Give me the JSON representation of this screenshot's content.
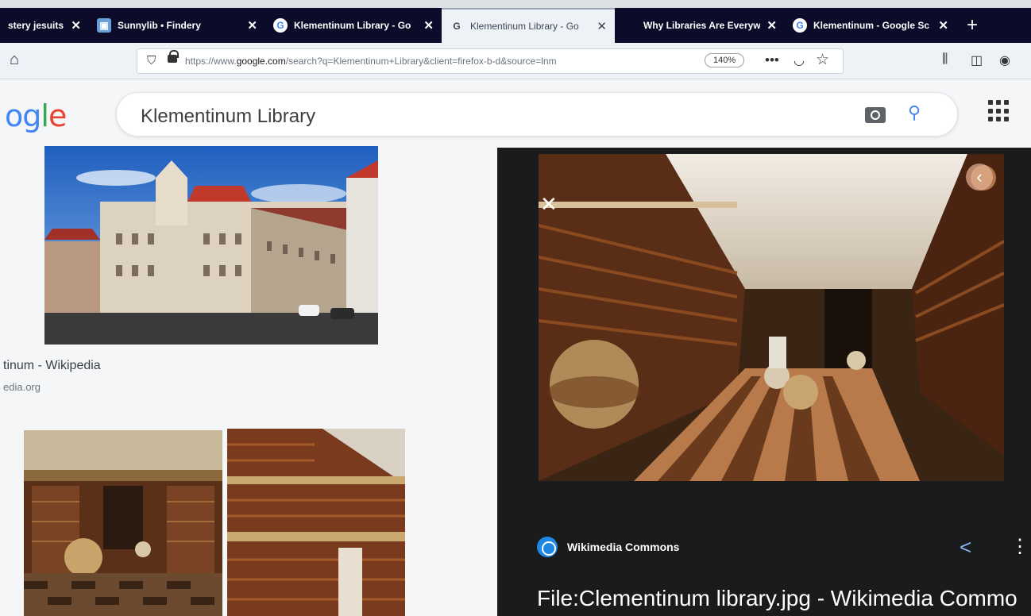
{
  "tabs": [
    {
      "title": "stery jesuits",
      "close": "✕"
    },
    {
      "title": "Sunnylib • Findery",
      "close": "✕"
    },
    {
      "title": "Klementinum Library - Go",
      "close": "✕"
    },
    {
      "title": "Klementinum Library - Go",
      "close": "✕"
    },
    {
      "title": "Why Libraries Are Everywh",
      "close": "✕"
    },
    {
      "title": "Klementinum - Google Sc",
      "close": "✕"
    }
  ],
  "new_tab": "+",
  "favicons": {
    "sunnylib": "▣",
    "google": "G"
  },
  "nav": {
    "url_prefix": "https://www.",
    "url_domain": "google.com",
    "url_rest": "/search?q=Klementinum+Library&client=firefox-b-d&source=lnm",
    "zoom": "140%"
  },
  "google": {
    "logo_parts": [
      "o",
      "g",
      "l",
      "e"
    ],
    "query": "Klementinum Library"
  },
  "results": {
    "title": "tinum - Wikipedia",
    "source": "edia.org"
  },
  "preview": {
    "source_name": "Wikimedia Commons",
    "file_title": "File:Clementinum library.jpg - Wikimedia Commo"
  },
  "colors": {
    "tab_bg": "#0c0c2a",
    "active_tab": "#eef2f7",
    "google_blue": "#4285f4",
    "google_red": "#ea4335",
    "google_green": "#34a853",
    "panel_bg": "#1a1b1d"
  }
}
